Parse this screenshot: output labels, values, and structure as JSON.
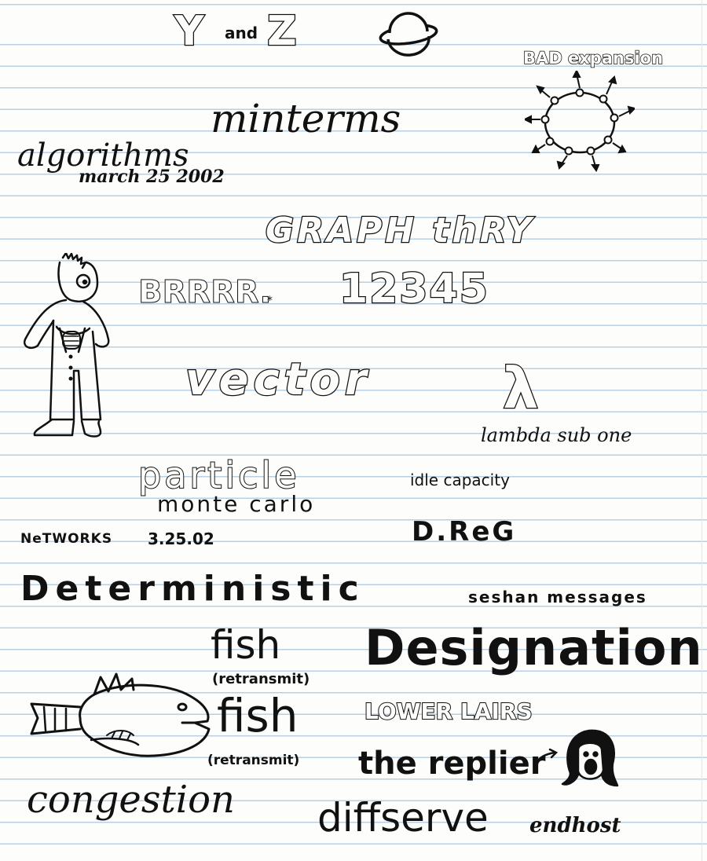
{
  "words": {
    "y_and_z": {
      "y": "Y",
      "and": "and",
      "z": "Z"
    },
    "bad_expansion": "BAD expansion",
    "minterms": "minterms",
    "algorithms": "algorithms",
    "date_long": "march 25 2002",
    "graph_thry": "GRAPH thRY",
    "brrrr": "BRRRR.",
    "brrrr_star": "*",
    "numbers": "12345",
    "vector": "vector",
    "lambda": "λ",
    "lambda_caption": "lambda sub one",
    "particle": "particle",
    "idle_capacity": "idle capacity",
    "monte_carlo": "monte carlo",
    "networks": "NeTWORKS",
    "date_short": "3.25.02",
    "dreg": "D.ReG",
    "deterministic": "Deterministic",
    "seshan_messages": "seshan messages",
    "fish_1": "fish",
    "retransmit_1": "(retransmit)",
    "designation": "Designation",
    "lower_lairs": "LOWER LAIRS",
    "fish_2": "fish",
    "retransmit_2": "(retransmit)",
    "the_replier": "the replier",
    "congestion": "congestion",
    "diffserve": "diffserve",
    "endhost": "endhost"
  },
  "ink_color": "#111111",
  "line_color": "#b8cfe4",
  "paper_color": "#fdfdfb"
}
